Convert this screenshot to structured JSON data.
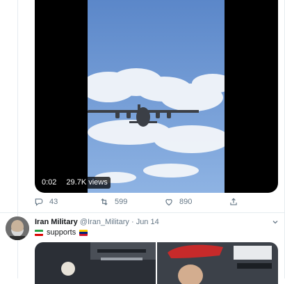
{
  "tweet1": {
    "video": {
      "time": "0:02",
      "views": "29.7K views"
    },
    "actions": {
      "replies": "43",
      "retweets": "599",
      "likes": "890"
    }
  },
  "tweet2": {
    "author_name": "Iran Military",
    "handle": "@Iran_Military",
    "separator": "·",
    "date": "Jun 14",
    "text": "supports"
  },
  "icons": {
    "reply": "reply-icon",
    "retweet": "retweet-icon",
    "like": "heart-icon",
    "share": "share-icon",
    "more": "chevron-down-icon"
  },
  "colors": {
    "muted": "#657786",
    "text": "#14171a",
    "divider": "#e6ecf0"
  }
}
